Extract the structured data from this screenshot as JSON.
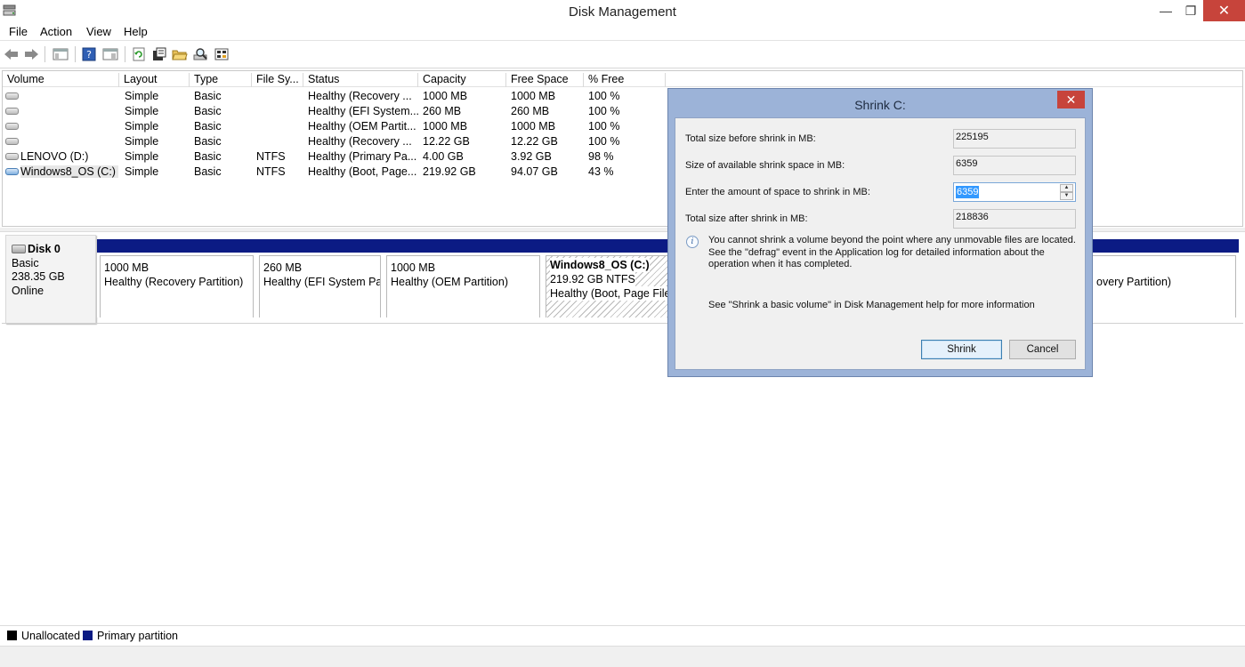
{
  "window": {
    "title": "Disk Management",
    "minimize_glyph": "—",
    "maximize_glyph": "❐",
    "close_glyph": "✕"
  },
  "menu": [
    "File",
    "Action",
    "View",
    "Help"
  ],
  "toolbar": {
    "icons": [
      "back-arrow-icon",
      "forward-arrow-icon",
      "show-hide-console-tree-icon",
      "help-icon",
      "properties-pane-icon",
      "refresh-icon",
      "properties-icon",
      "open-folder-icon",
      "search-drive-icon",
      "disk-settings-icon"
    ]
  },
  "volume_list": {
    "columns": [
      "Volume",
      "Layout",
      "Type",
      "File Sy...",
      "Status",
      "Capacity",
      "Free Space",
      "% Free"
    ],
    "rows": [
      {
        "volume": "",
        "layout": "Simple",
        "type": "Basic",
        "fs": "",
        "status": "Healthy (Recovery ...",
        "capacity": "1000 MB",
        "free": "1000 MB",
        "pct": "100 %"
      },
      {
        "volume": "",
        "layout": "Simple",
        "type": "Basic",
        "fs": "",
        "status": "Healthy (EFI System...",
        "capacity": "260 MB",
        "free": "260 MB",
        "pct": "100 %"
      },
      {
        "volume": "",
        "layout": "Simple",
        "type": "Basic",
        "fs": "",
        "status": "Healthy (OEM Partit...",
        "capacity": "1000 MB",
        "free": "1000 MB",
        "pct": "100 %"
      },
      {
        "volume": "",
        "layout": "Simple",
        "type": "Basic",
        "fs": "",
        "status": "Healthy (Recovery ...",
        "capacity": "12.22 GB",
        "free": "12.22 GB",
        "pct": "100 %"
      },
      {
        "volume": "LENOVO (D:)",
        "layout": "Simple",
        "type": "Basic",
        "fs": "NTFS",
        "status": "Healthy (Primary Pa...",
        "capacity": "4.00 GB",
        "free": "3.92 GB",
        "pct": "98 %"
      },
      {
        "volume": "Windows8_OS (C:)",
        "layout": "Simple",
        "type": "Basic",
        "fs": "NTFS",
        "status": "Healthy (Boot, Page...",
        "capacity": "219.92 GB",
        "free": "94.07 GB",
        "pct": "43 %"
      }
    ]
  },
  "disk": {
    "name": "Disk 0",
    "type": "Basic",
    "size": "238.35 GB",
    "state": "Online",
    "partitions": [
      {
        "line1": "",
        "line2": "1000 MB",
        "line3": "Healthy (Recovery Partition)"
      },
      {
        "line1": "",
        "line2": "260 MB",
        "line3": "Healthy (EFI System Par"
      },
      {
        "line1": "",
        "line2": "1000 MB",
        "line3": "Healthy (OEM Partition)"
      },
      {
        "line1": "Windows8_OS  (C:)",
        "line2": "219.92 GB NTFS",
        "line3": "Healthy (Boot, Page File,"
      },
      {
        "line1": "",
        "line2": "",
        "line3": "overy Partition)"
      }
    ]
  },
  "legend": {
    "unallocated": "Unallocated",
    "primary": "Primary partition",
    "unallocated_color": "#000000",
    "primary_color": "#0b1b84"
  },
  "dialog": {
    "title": "Shrink C:",
    "total_before_label": "Total size before shrink in MB:",
    "total_before_value": "225195",
    "available_label": "Size of available shrink space in MB:",
    "available_value": "6359",
    "amount_label": "Enter the amount of space to shrink in MB:",
    "amount_value": "6359",
    "total_after_label": "Total size after shrink in MB:",
    "total_after_value": "218836",
    "info_text": "You cannot shrink a volume beyond the point where any unmovable files are located. See the \"defrag\" event in the Application log for detailed information about the operation when it has completed.",
    "see_text": "See \"Shrink a basic volume\" in Disk Management help for more information",
    "shrink_button": "Shrink",
    "cancel_button": "Cancel",
    "info_glyph": "i",
    "close_glyph": "✕"
  }
}
